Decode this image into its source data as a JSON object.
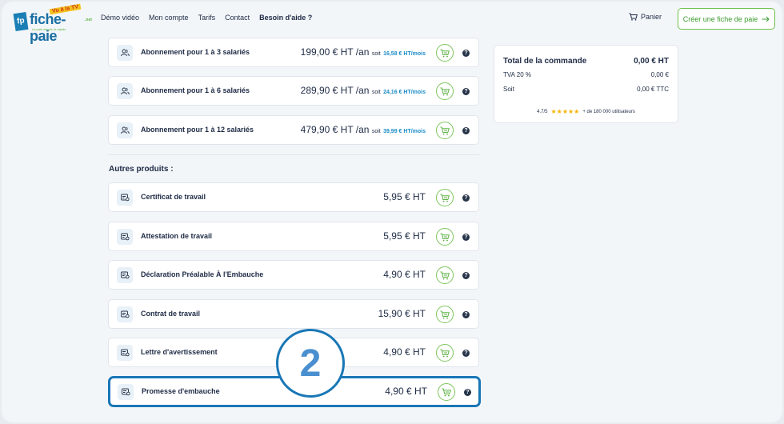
{
  "header": {
    "logo": {
      "initials": "fp",
      "name": "fiche-paie",
      "badge": "Vu à la TV",
      "tld": ".net",
      "tagline": "La paie simple et rapide"
    },
    "nav": [
      {
        "label": "Démo vidéo",
        "bold": false
      },
      {
        "label": "Mon compte",
        "bold": false
      },
      {
        "label": "Tarifs",
        "bold": false
      },
      {
        "label": "Contact",
        "bold": false
      },
      {
        "label": "Besoin d'aide ?",
        "bold": true
      }
    ],
    "cart_label": "Panier",
    "cta_label": "Créer une fiche de paie"
  },
  "subscriptions": [
    {
      "label": "Abonnement pour 1 à 3 salariés",
      "price": "199,00 € HT /an",
      "sub": "soit",
      "per_month": "16,58 € HT/mois"
    },
    {
      "label": "Abonnement pour 1 à 6 salariés",
      "price": "289,90 € HT /an",
      "sub": "soit",
      "per_month": "24,16 € HT/mois"
    },
    {
      "label": "Abonnement pour 1 à 12 salariés",
      "price": "479,90 € HT /an",
      "sub": "soit",
      "per_month": "39,99 € HT/mois"
    }
  ],
  "other_title": "Autres produits :",
  "products": [
    {
      "label": "Certificat de travail",
      "price": "5,95 € HT"
    },
    {
      "label": "Attestation de travail",
      "price": "5,95 € HT"
    },
    {
      "label": "Déclaration Préalable À l'Embauche",
      "price": "4,90 € HT"
    },
    {
      "label": "Contrat de travail",
      "price": "15,90 € HT"
    },
    {
      "label": "Lettre d'avertissement",
      "price": "4,90 € HT"
    },
    {
      "label": "Promesse d'embauche",
      "price": "4,90 € HT"
    }
  ],
  "help_glyph": "?",
  "summary": {
    "total_label": "Total de la commande",
    "total_value": "0,00 € HT",
    "tva_label": "TVA 20 %",
    "tva_value": "0,00 €",
    "soit_label": "Soit",
    "soit_value": "0,00 € TTC",
    "rating": "4.7/5",
    "stars": "★★★★★",
    "users": "+ de 180 000 utilisateurs"
  },
  "callout_number": "2",
  "colors": {
    "accent_blue": "#1977b6",
    "accent_green": "#6cc04a",
    "text_dark": "#1e2b45",
    "link_blue": "#1a8cc8"
  }
}
